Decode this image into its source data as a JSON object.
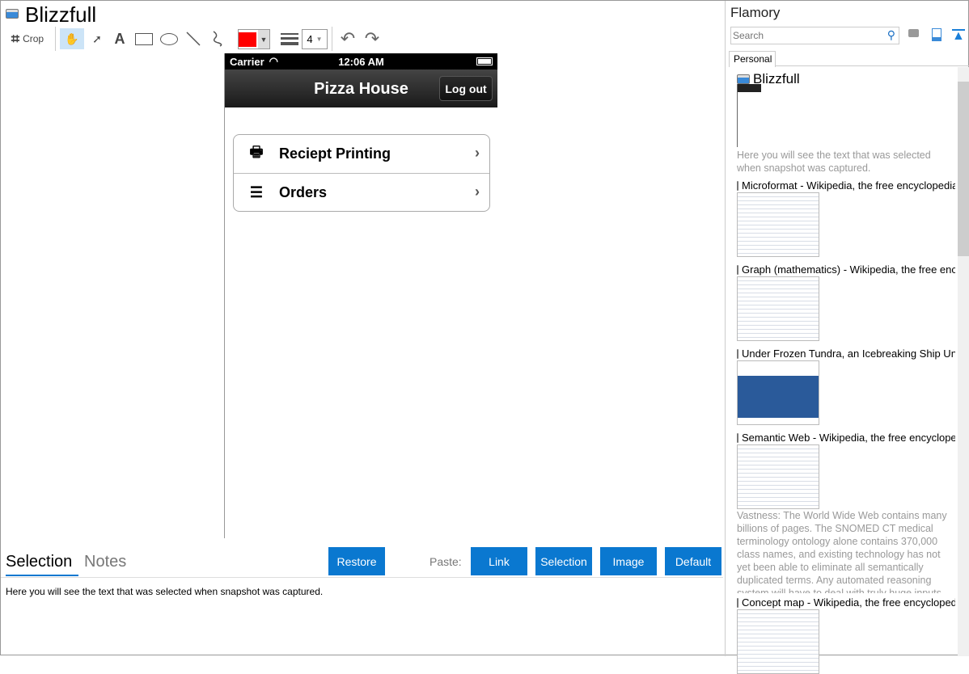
{
  "window": {
    "title": "Blizzfull"
  },
  "toolbar": {
    "crop_label": "Crop",
    "line_width": "4",
    "color": "#ff0000"
  },
  "phone": {
    "carrier": "Carrier",
    "time": "12:06 AM",
    "nav_title": "Pizza House",
    "logout": "Log out",
    "rows": [
      {
        "label": "Reciept Printing",
        "icon": "printer-icon"
      },
      {
        "label": "Orders",
        "icon": "list-icon"
      }
    ]
  },
  "bottom": {
    "tabs": [
      "Selection",
      "Notes"
    ],
    "restore": "Restore",
    "paste_label": "Paste:",
    "paste_buttons": [
      "Link",
      "Selection",
      "Image",
      "Default"
    ],
    "selection_text": "Here you will see the text that was selected when snapshot was captured."
  },
  "sidebar": {
    "title": "Flamory",
    "search_placeholder": "Search",
    "tab": "Personal",
    "items": [
      {
        "title": "Blizzfull",
        "note": "Here you will see the text that was selected when snapshot was captured."
      },
      {
        "title": "Microformat - Wikipedia, the free encyclopedia"
      },
      {
        "title": "Graph (mathematics) - Wikipedia, the free encyclopedia"
      },
      {
        "title": "Under Frozen Tundra, an Icebreaking Ship Uncovers"
      },
      {
        "title": "Semantic Web - Wikipedia, the free encyclopedia",
        "note": "Vastness: The World Wide Web contains many billions of pages. The SNOMED CT medical terminology ontology alone contains 370,000 class names, and existing technology has not yet been able to eliminate all semantically duplicated terms. Any automated reasoning system will have to deal with truly huge inputs."
      },
      {
        "title": "Concept map - Wikipedia, the free encyclopedia"
      }
    ]
  }
}
